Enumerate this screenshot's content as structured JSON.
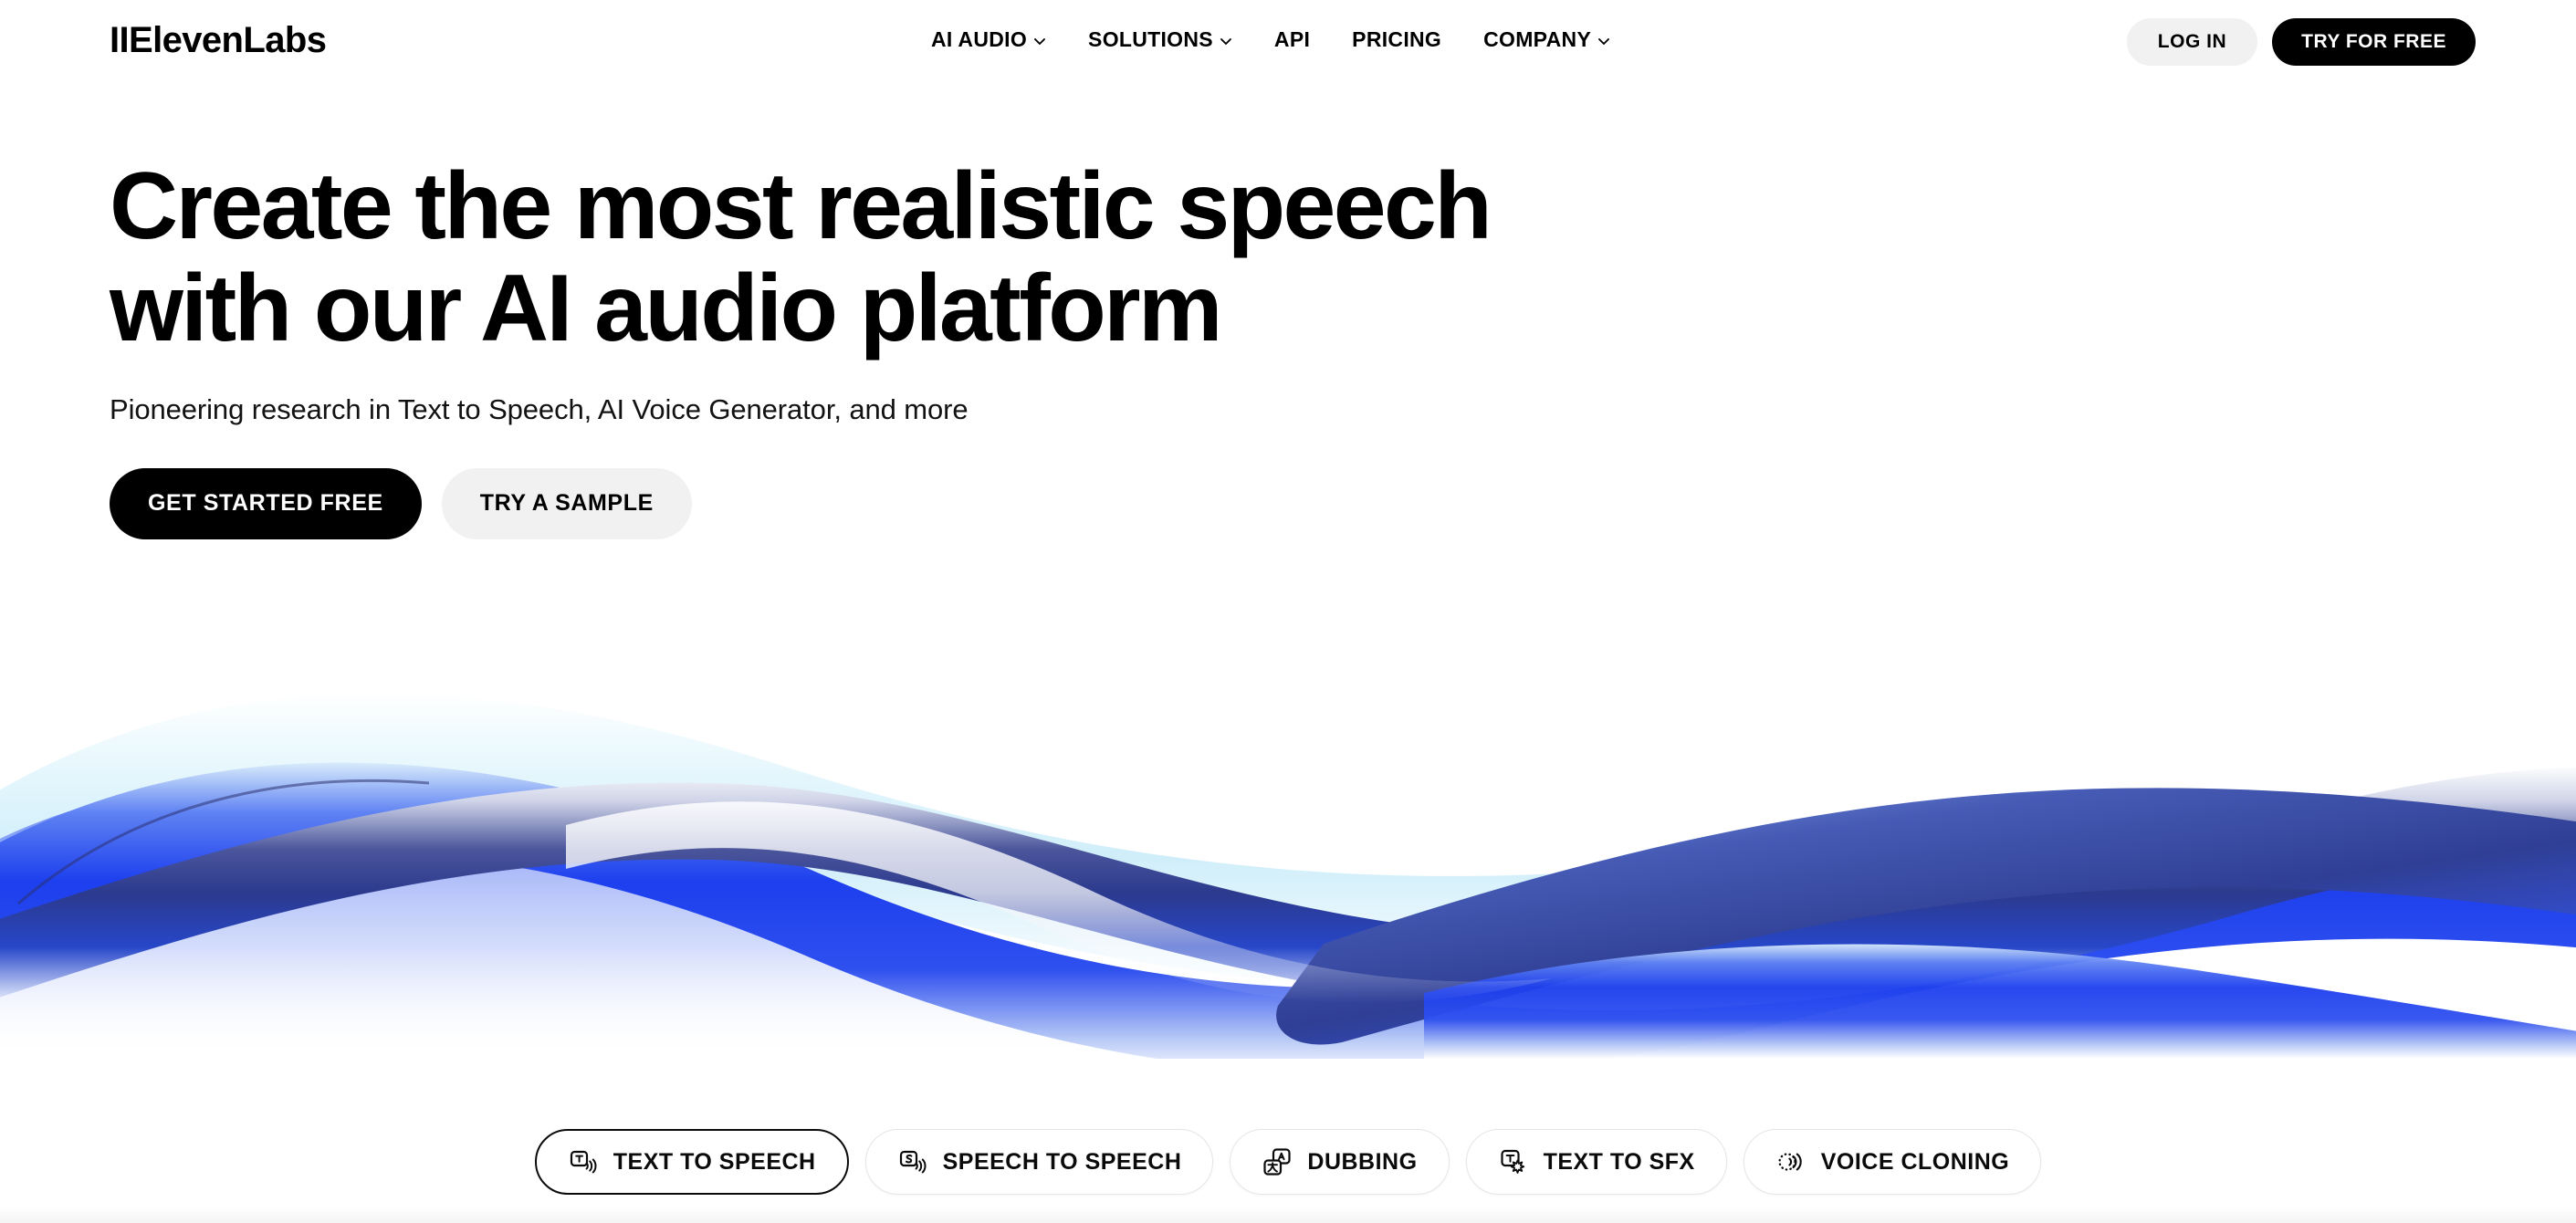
{
  "header": {
    "logo": "IIElevenLabs",
    "nav": [
      {
        "label": "AI AUDIO",
        "has_caret": true,
        "icon": "chevron-down-icon"
      },
      {
        "label": "SOLUTIONS",
        "has_caret": true,
        "icon": "chevron-down-icon"
      },
      {
        "label": "API",
        "has_caret": false
      },
      {
        "label": "PRICING",
        "has_caret": false
      },
      {
        "label": "COMPANY",
        "has_caret": true,
        "icon": "chevron-down-icon"
      }
    ],
    "login_label": "LOG IN",
    "try_label": "TRY FOR FREE"
  },
  "hero": {
    "headline": "Create the most realistic speech\nwith our AI audio platform",
    "subhead": "Pioneering research in Text to Speech, AI Voice Generator, and more",
    "cta_primary": "GET STARTED FREE",
    "cta_secondary": "TRY A SAMPLE"
  },
  "tabs": [
    {
      "label": "TEXT TO SPEECH",
      "icon": "text-to-speech-icon",
      "active": true
    },
    {
      "label": "SPEECH TO SPEECH",
      "icon": "speech-to-speech-icon",
      "active": false
    },
    {
      "label": "DUBBING",
      "icon": "dubbing-translate-icon",
      "active": false
    },
    {
      "label": "TEXT TO SFX",
      "icon": "text-to-sfx-icon",
      "active": false
    },
    {
      "label": "VOICE CLONING",
      "icon": "voice-cloning-icon",
      "active": false
    }
  ],
  "colors": {
    "text": "#000000",
    "button_dark": "#000000",
    "button_light": "#f1f1f1",
    "wave_blue": "#1d3fee",
    "wave_deep": "#2b3f9e",
    "wave_pale": "#d7f2fb",
    "pill_border": "#e6e6e6",
    "pill_active_border": "#0a0a0a"
  }
}
